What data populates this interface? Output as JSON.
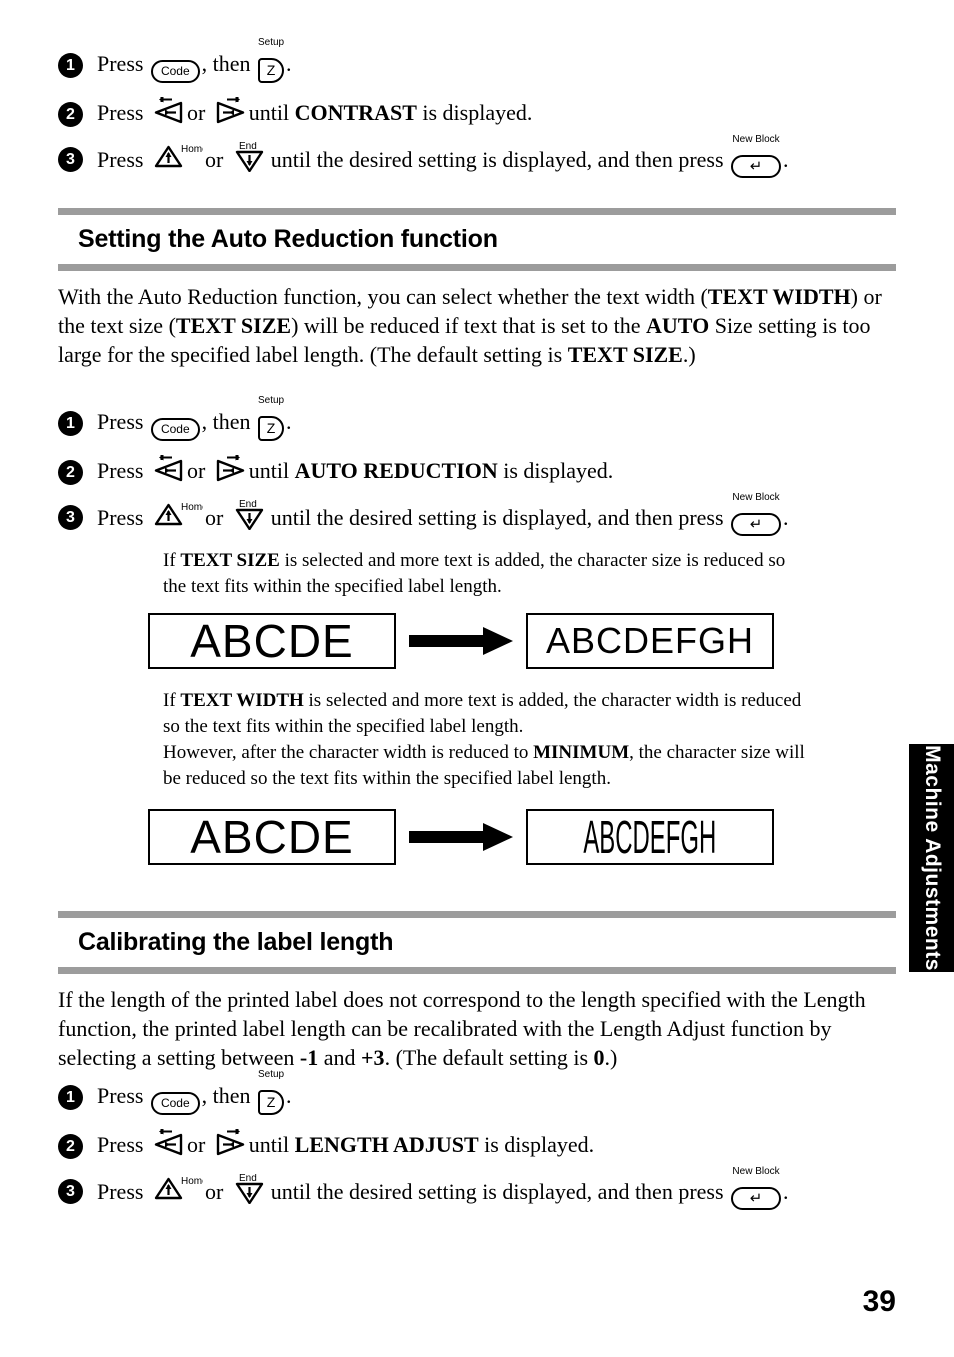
{
  "page": {
    "number": "39",
    "side_tab_label": "Machine Adjustments"
  },
  "keys": {
    "code": "Code",
    "z": "Z",
    "z_label": "Setup",
    "enter": "↵",
    "enter_label": "New Block",
    "up_label": "Home",
    "down_label": "End"
  },
  "contrast_steps": [
    {
      "number": "1",
      "before": "Press",
      "mid": ", then",
      "after": "."
    },
    {
      "number": "2",
      "before": "Press",
      "mid": "or",
      "after": "until",
      "term": "CONTRAST",
      "tail": "is displayed."
    },
    {
      "number": "3",
      "before": "Press",
      "mid": "or",
      "after": "until the desired setting is displayed, and then press",
      "tail": "."
    }
  ],
  "section_auto_reduction": {
    "title": "Setting the Auto Reduction function",
    "intro": {
      "p1": "With the Auto Reduction function, you can select whether the text width (",
      "b1": "TEXT WIDTH",
      "p2": ") or the text size (",
      "b2": "TEXT SIZE",
      "p3": ") will be reduced if text that is set to the ",
      "b3": "AUTO",
      "p4": " Size setting is too large for the specified label length. (The default setting is ",
      "b4": "TEXT SIZE",
      "p5": ".)"
    },
    "steps": [
      {
        "number": "1",
        "before": "Press",
        "mid": ", then",
        "after": "."
      },
      {
        "number": "2",
        "before": "Press",
        "mid": "or",
        "after": "until",
        "term": "AUTO REDUCTION",
        "tail": "is displayed."
      },
      {
        "number": "3",
        "before": "Press",
        "mid": "or",
        "after": "until the desired setting is displayed, and then press",
        "tail": "."
      }
    ],
    "note_size": {
      "p1": "If ",
      "b1": "TEXT SIZE",
      "p2": " is selected and more text is added, the character size is reduced so the text fits within the specified label length."
    },
    "note_width": {
      "p1": "If ",
      "b1": "TEXT WIDTH",
      "p2": " is selected and more text is added, the character width is reduced so the text fits within the specified label length.",
      "p3": "However, after the character width is reduced to ",
      "b2": "MINIMUM",
      "p4": ", the character size will be reduced so the text fits within the specified label length."
    },
    "illustration_size": {
      "left_label": "ABCDE",
      "right_label": "ABCDEFGH"
    },
    "illustration_width": {
      "left_label": "ABCDE",
      "right_label": "ABCDEFGH"
    }
  },
  "section_calibrating": {
    "title": "Calibrating the label length",
    "intro": {
      "p1": "If the length of the printed label does not correspond to the length specified with the Length function, the printed label length can be recalibrated with the Length Adjust function by selecting a setting between ",
      "b1": "-1",
      "p2": " and ",
      "b2": "+3",
      "p3": ". (The default setting is ",
      "b3": "0",
      "p4": ".)"
    },
    "steps": [
      {
        "number": "1",
        "before": "Press",
        "mid": ", then",
        "after": "."
      },
      {
        "number": "2",
        "before": "Press",
        "mid": "or",
        "after": "until",
        "term": "LENGTH ADJUST",
        "tail": "is displayed."
      },
      {
        "number": "3",
        "before": "Press",
        "mid": "or",
        "after": "until the desired setting is displayed, and then press",
        "tail": "."
      }
    ]
  }
}
